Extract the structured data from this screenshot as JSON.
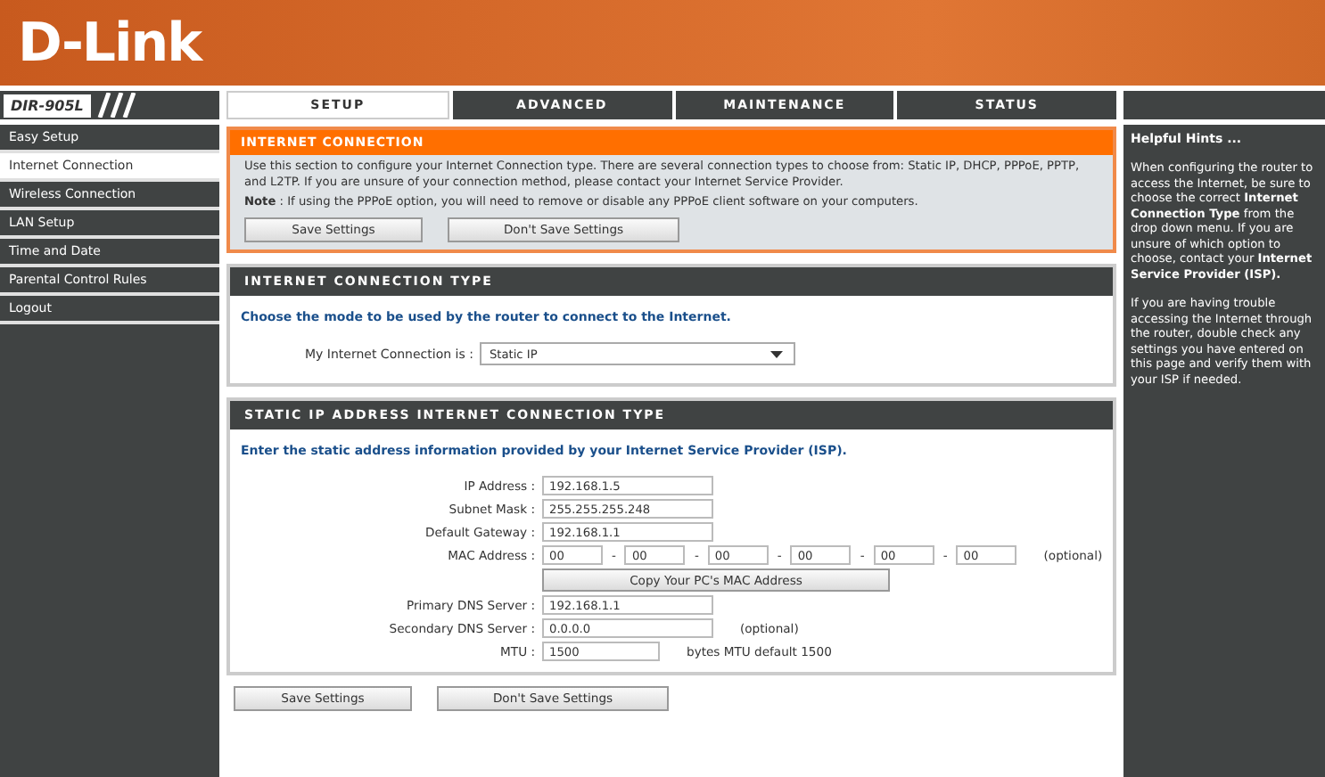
{
  "header": {
    "logo": "D-Link"
  },
  "model": "DIR-905L",
  "tabs": [
    {
      "label": "SETUP",
      "selected": true
    },
    {
      "label": "ADVANCED",
      "selected": false
    },
    {
      "label": "MAINTENANCE",
      "selected": false
    },
    {
      "label": "STATUS",
      "selected": false
    }
  ],
  "sidebar": {
    "items": [
      {
        "label": "Easy Setup",
        "selected": false
      },
      {
        "label": "Internet Connection",
        "selected": true
      },
      {
        "label": "Wireless Connection",
        "selected": false
      },
      {
        "label": "LAN Setup",
        "selected": false
      },
      {
        "label": "Time and Date",
        "selected": false
      },
      {
        "label": "Parental Control Rules",
        "selected": false
      },
      {
        "label": "Logout",
        "selected": false
      }
    ]
  },
  "internet_connection": {
    "title": "INTERNET CONNECTION",
    "text": "Use this section to configure your Internet Connection type. There are several connection types to choose from: Static IP, DHCP, PPPoE, PPTP, and L2TP. If you are unsure of your connection method, please contact your Internet Service Provider.",
    "note": "**Note** : If using the PPPoE option, you will need to remove or disable any PPPoE client software on your computers.",
    "buttons": [
      "Save Settings",
      "Don't Save Settings"
    ]
  },
  "connection_type": {
    "title": "INTERNET CONNECTION TYPE",
    "instruction": "Choose the mode to be used by the router to connect to the Internet.",
    "label": "My Internet Connection is :",
    "value": "Static IP"
  },
  "static_ip": {
    "title": "STATIC IP ADDRESS INTERNET CONNECTION TYPE",
    "instruction": "Enter the static address information provided by your Internet Service Provider (ISP).",
    "rows": [
      {
        "kind": "text",
        "label": "IP Address :",
        "value": "192.168.1.5"
      },
      {
        "kind": "text",
        "label": "Subnet Mask :",
        "value": "255.255.255.248"
      },
      {
        "kind": "text",
        "label": "Default Gateway :",
        "value": "192.168.1.1"
      },
      {
        "kind": "mac",
        "label": "MAC Address :",
        "values": [
          "00",
          "00",
          "00",
          "00",
          "00",
          "00"
        ],
        "separator": "-",
        "suffix": "(optional)"
      },
      {
        "kind": "button",
        "label": "Copy Your PC's MAC Address"
      },
      {
        "kind": "text",
        "label": "Primary DNS Server :",
        "value": "192.168.1.1"
      },
      {
        "kind": "text",
        "label": "Secondary DNS Server :",
        "value": "0.0.0.0",
        "suffix": "(optional)"
      },
      {
        "kind": "short",
        "label": "MTU :",
        "value": "1500",
        "suffix": "bytes MTU default 1500"
      }
    ]
  },
  "bottom_buttons": [
    "Save Settings",
    "Don't Save Settings"
  ],
  "hints": {
    "title": "Helpful Hints ...",
    "paragraphs": [
      "When configuring the router to access the Internet, be sure to choose the correct **Internet Connection Type** from the drop down menu. If you are unsure of which option to choose, contact your **Internet Service Provider (ISP).**",
      "If you are having trouble accessing the Internet through the router, double check any settings you have entered on this page and verify them with your ISP if needed."
    ]
  }
}
